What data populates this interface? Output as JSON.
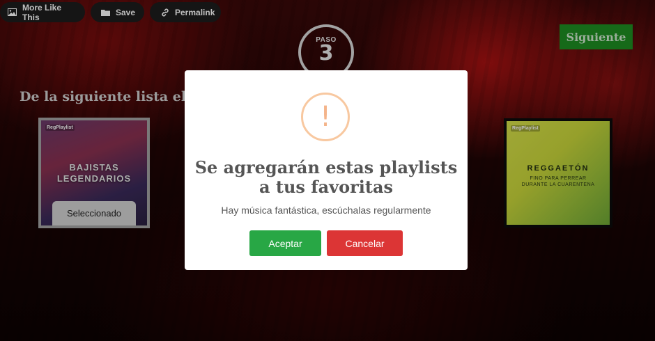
{
  "toolbar": {
    "more_like_this": "More Like This",
    "save": "Save",
    "permalink": "Permalink"
  },
  "step": {
    "label": "PASO",
    "number": "3"
  },
  "next_button": "Siguiente",
  "heading": "De la siguiente lista elig",
  "cards": {
    "left": {
      "tag": "RegPlaylist",
      "title_line1": "BAJISTAS",
      "title_line2": "LEGENDARIOS",
      "selected_label": "Seleccionado"
    },
    "right": {
      "tag": "RegPlaylist",
      "title": "REGGAETÓN",
      "sub_line1": "FINO PARA PERREAR",
      "sub_line2": "DURANTE LA CUARENTENA"
    }
  },
  "modal": {
    "icon": "!",
    "title": "Se agregarán estas playlists a tus favoritas",
    "message": "Hay música fantástica, escúchalas regularmente",
    "confirm": "Aceptar",
    "cancel": "Cancelar"
  },
  "colors": {
    "confirm": "#28a745",
    "cancel": "#dc3535",
    "next": "#1e8e22",
    "warning": "#f8c8a0"
  },
  "icons": {
    "more_like_this": "image-icon",
    "save": "folder-icon",
    "permalink": "link-icon"
  }
}
